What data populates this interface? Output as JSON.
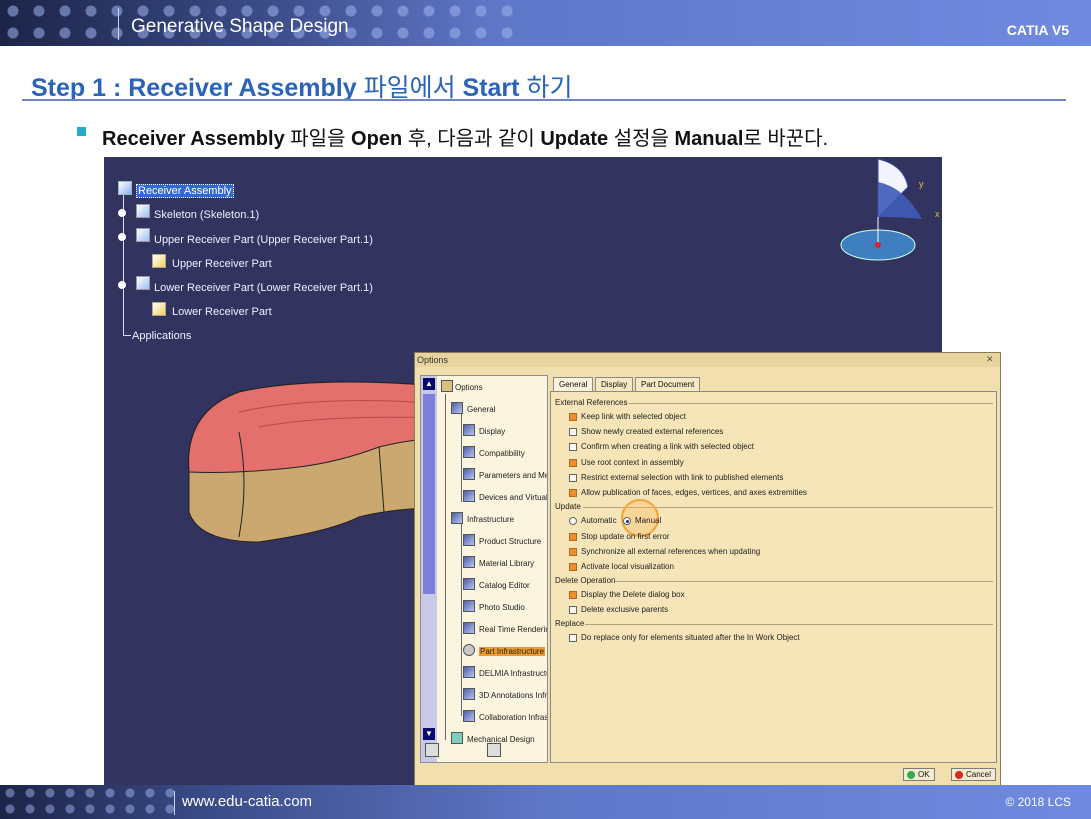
{
  "header": {
    "title": "Generative Shape Design",
    "brand": "CATIA V5"
  },
  "step": {
    "prefix": "Step 1 : Receiver Assembly",
    "suffix": " 파일에서 ",
    "strong2": "Start",
    "suffix2": " 하기"
  },
  "bullet": {
    "p1": "Receiver Assembly",
    "p2": " 파일을 ",
    "p3": "Open",
    "p4": " 후, 다음과 같이 ",
    "p5": "Update",
    "p6": " 설정을 ",
    "p7": "Manual",
    "p8": "로 바꾼다."
  },
  "tree": {
    "root": "Receiver Assembly",
    "n1": "Skeleton (Skeleton.1)",
    "n2": "Upper Receiver Part (Upper Receiver Part.1)",
    "n2c": "Upper Receiver Part",
    "n3": "Lower Receiver Part (Lower Receiver Part.1)",
    "n3c": "Lower Receiver Part",
    "n4": "Applications"
  },
  "axis": {
    "y": "y",
    "x": "x"
  },
  "dialog": {
    "title": "Options",
    "left": {
      "root": "Options",
      "general": "General",
      "display": "Display",
      "compatibility": "Compatibility",
      "params": "Parameters and Mea",
      "devices": "Devices and Virtual R",
      "infrastructure": "Infrastructure",
      "product": "Product Structure",
      "material": "Material Library",
      "catalog": "Catalog Editor",
      "photo": "Photo Studio",
      "realtime": "Real Time Rendering",
      "part": "Part Infrastructure",
      "delmia": "DELMIA Infrastructur",
      "ann3d": "3D Annotations Infra",
      "collab": "Collaboration Infrast",
      "mech": "Mechanical Design"
    },
    "tabs": [
      "General",
      "Display",
      "Part Document"
    ],
    "groups": {
      "ext": "External References",
      "update": "Update",
      "delete": "Delete Operation",
      "replace": "Replace"
    },
    "options": {
      "keep": "Keep link with selected object",
      "shownew": "Show newly created external references",
      "confirm": "Confirm when creating a link with selected object",
      "useroot": "Use root context in assembly",
      "restrict": "Restrict external selection with link to published elements",
      "allowpub": "Allow publication of faces, edges, vertices, and axes extremities",
      "automatic": "Automatic",
      "manual": "Manual",
      "stopupdate": "Stop update on first error",
      "sync": "Synchronize all external references when updating",
      "activate": "Activate local visualization",
      "displaydel": "Display the Delete dialog box",
      "delexcl": "Delete exclusive parents",
      "doreplace": "Do replace only for elements situated after the In Work Object"
    },
    "buttons": {
      "ok": "OK",
      "cancel": "Cancel"
    }
  },
  "footer": {
    "url": "www.edu-catia.com",
    "copyright": "© 2018 LCS"
  },
  "colors": {
    "accent": "#2a63b8",
    "catia_bg": "#32335e",
    "dialog_bg": "#f1dfb0",
    "checked": "#f08d2e"
  }
}
